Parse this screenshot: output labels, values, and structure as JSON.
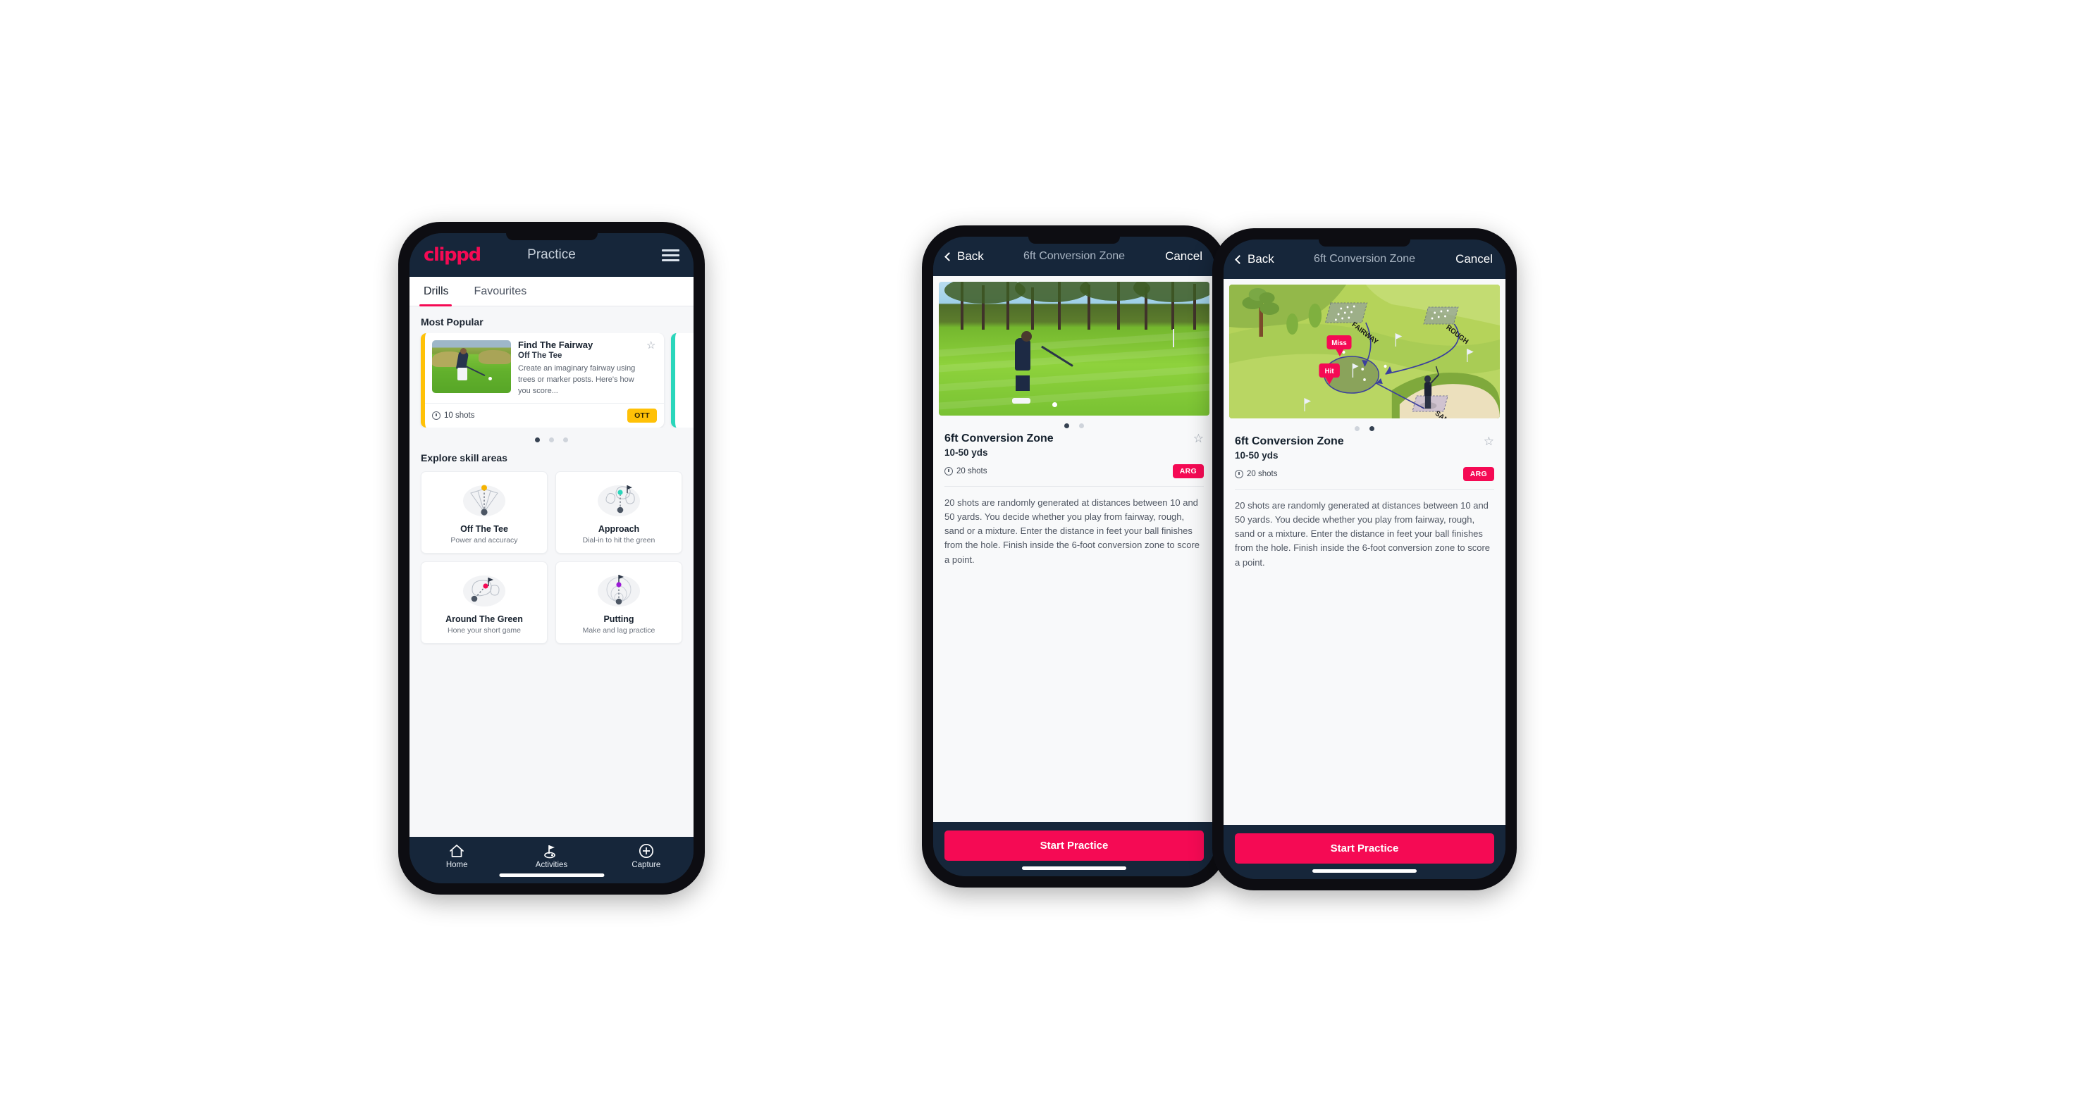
{
  "phone1": {
    "appbar": {
      "brand": "clippd",
      "title": "Practice",
      "menu_icon": "hamburger-menu-icon"
    },
    "tabs": [
      {
        "label": "Drills",
        "active": true
      },
      {
        "label": "Favourites",
        "active": false
      }
    ],
    "sections": {
      "most_popular_label": "Most Popular",
      "explore_label": "Explore skill areas"
    },
    "drill_card": {
      "title": "Find The Fairway",
      "subtitle": "Off The Tee",
      "description": "Create an imaginary fairway using trees or marker posts. Here's how you score...",
      "shots": "10 shots",
      "badge": "OTT",
      "badge_color": "#FFC107",
      "accent_color": "#FFC107",
      "next_card_accent": "#2ad6bb",
      "star_icon": "star-outline-icon",
      "clock_icon": "clock-icon"
    },
    "carousel_dots": {
      "count": 3,
      "active_index": 0
    },
    "skill_areas": [
      {
        "name": "Off The Tee",
        "desc": "Power and accuracy",
        "icon": "tee-shot-fan-icon",
        "accent": "#F5B301"
      },
      {
        "name": "Approach",
        "desc": "Dial-in to hit the green",
        "icon": "approach-green-icon",
        "accent": "#2ad6bb"
      },
      {
        "name": "Around The Green",
        "desc": "Hone your short game",
        "icon": "around-green-icon",
        "accent": "#f50a54"
      },
      {
        "name": "Putting",
        "desc": "Make and lag practice",
        "icon": "putting-rings-icon",
        "accent": "#9b1ad6"
      }
    ],
    "bottom_nav": [
      {
        "label": "Home",
        "icon": "home-icon",
        "active": false
      },
      {
        "label": "Activities",
        "icon": "golf-flag-icon",
        "active": true
      },
      {
        "label": "Capture",
        "icon": "plus-circle-icon",
        "active": false
      }
    ]
  },
  "phone2": {
    "appbar": {
      "back": "Back",
      "title": "6ft Conversion Zone",
      "cancel": "Cancel",
      "back_icon": "chevron-left-icon"
    },
    "media": {
      "type": "photo",
      "alt": "golfer-chipping-photo"
    },
    "carousel_dots": {
      "count": 2,
      "active_index": 0
    },
    "detail": {
      "title": "6ft Conversion Zone",
      "yards": "10-50 yds",
      "shots": "20 shots",
      "badge": "ARG",
      "badge_color": "#f50a54",
      "star_icon": "star-outline-icon",
      "clock_icon": "clock-icon",
      "description": "20 shots are randomly generated at distances between 10 and 50 yards. You decide whether you play from fairway, rough, sand or a mixture. Enter the distance in feet your ball finishes from the hole. Finish inside the 6-foot conversion zone to score a point."
    },
    "cta": {
      "label": "Start Practice",
      "color": "#f50a54"
    }
  },
  "phone3": {
    "appbar": {
      "back": "Back",
      "title": "6ft Conversion Zone",
      "cancel": "Cancel",
      "back_icon": "chevron-left-icon"
    },
    "media": {
      "type": "illustration",
      "alt": "golf-hole-diagram",
      "labels": {
        "fairway": "FAIRWAY",
        "rough": "ROUGH",
        "sand": "SAND",
        "miss": "Miss",
        "hit": "Hit"
      },
      "callout_color": "#f50a54",
      "arrow_color": "#3b3f9e"
    },
    "carousel_dots": {
      "count": 2,
      "active_index": 1
    },
    "detail": {
      "title": "6ft Conversion Zone",
      "yards": "10-50 yds",
      "shots": "20 shots",
      "badge": "ARG",
      "badge_color": "#f50a54",
      "star_icon": "star-outline-icon",
      "clock_icon": "clock-icon",
      "description": "20 shots are randomly generated at distances between 10 and 50 yards. You decide whether you play from fairway, rough, sand or a mixture. Enter the distance in feet your ball finishes from the hole. Finish inside the 6-foot conversion zone to score a point."
    },
    "cta": {
      "label": "Start Practice",
      "color": "#f50a54"
    }
  }
}
